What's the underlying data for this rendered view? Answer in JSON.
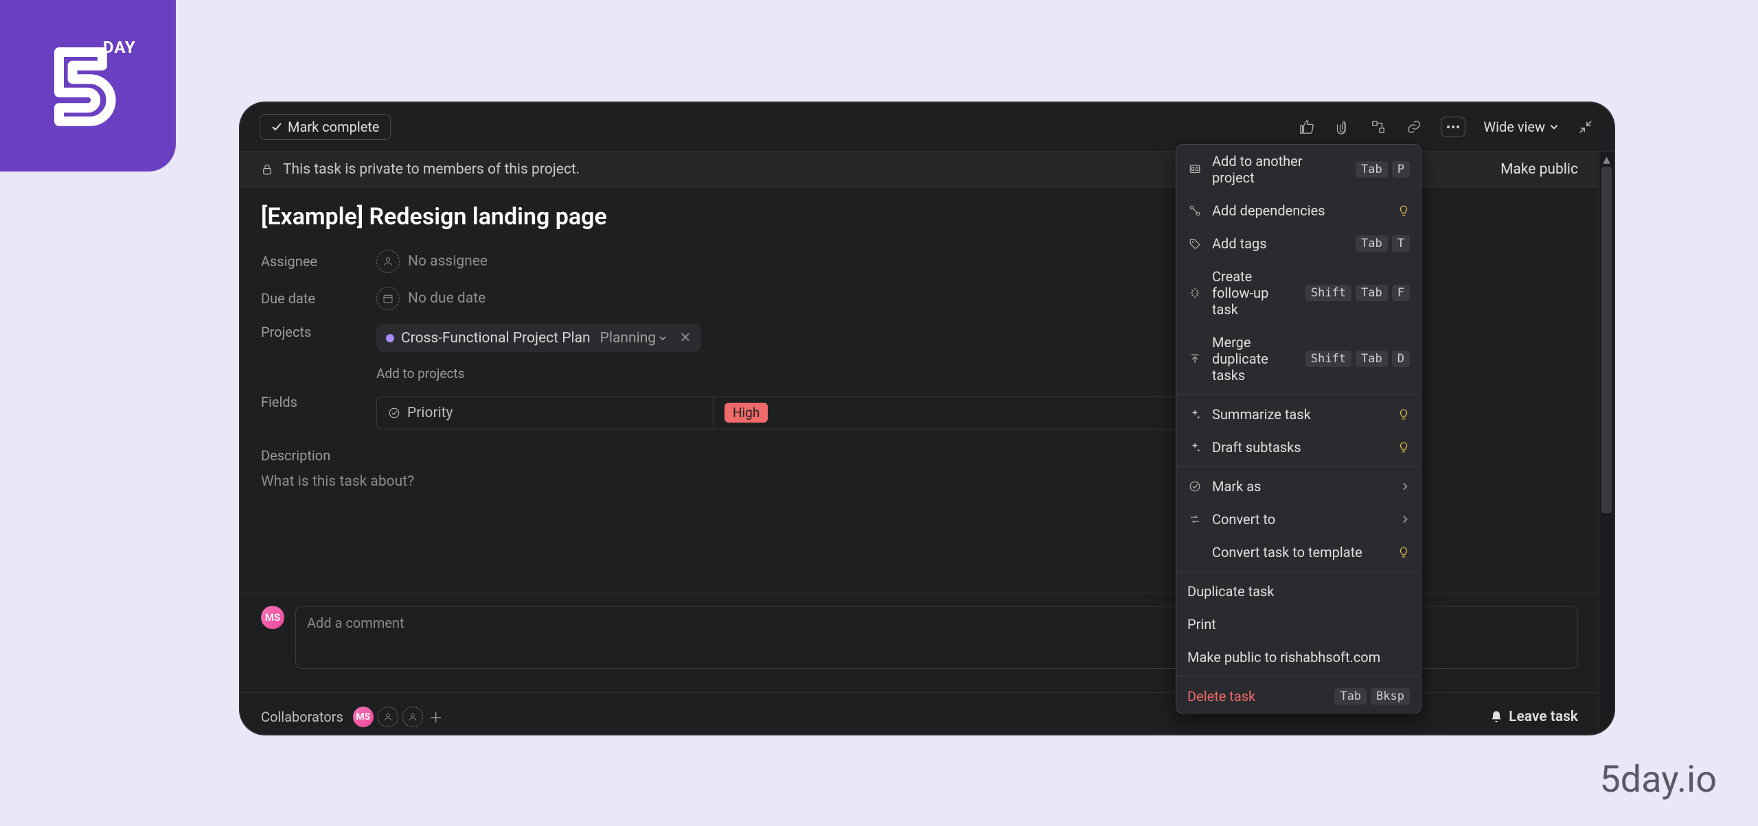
{
  "branding": {
    "logo_day": "DAY",
    "footer_url": "5day.io"
  },
  "topbar": {
    "mark_complete": "Mark complete",
    "wide_view": "Wide view"
  },
  "privacy": {
    "message": "This task is private to members of this project.",
    "make_public": "Make public"
  },
  "task": {
    "title": "[Example] Redesign landing page",
    "labels": {
      "assignee": "Assignee",
      "due_date": "Due date",
      "projects": "Projects",
      "fields": "Fields",
      "description": "Description"
    },
    "assignee_value": "No assignee",
    "due_date_value": "No due date",
    "project_name": "Cross-Functional Project Plan",
    "project_section": "Planning",
    "add_to_projects": "Add to projects",
    "custom_field_name": "Priority",
    "custom_field_value": "High",
    "description_placeholder": "What is this task about?"
  },
  "comment": {
    "placeholder": "Add a comment",
    "avatar": "MS"
  },
  "footer": {
    "collaborators_label": "Collaborators",
    "avatar": "MS",
    "leave_task": "Leave task"
  },
  "menu": {
    "items": [
      {
        "icon": "project",
        "label": "Add to another project",
        "shortcut": [
          "Tab",
          "P"
        ]
      },
      {
        "icon": "deps",
        "label": "Add dependencies",
        "badge": "bulb"
      },
      {
        "icon": "tag",
        "label": "Add tags",
        "shortcut": [
          "Tab",
          "T"
        ]
      },
      {
        "icon": "loader",
        "label": "Create follow-up task",
        "shortcut": [
          "Shift",
          "Tab",
          "F"
        ]
      },
      {
        "icon": "merge",
        "label": "Merge duplicate tasks",
        "shortcut": [
          "Shift",
          "Tab",
          "D"
        ]
      }
    ],
    "ai_items": [
      {
        "icon": "sparkle",
        "label": "Summarize task",
        "badge": "bulb"
      },
      {
        "icon": "sparkle",
        "label": "Draft subtasks",
        "badge": "bulb"
      }
    ],
    "submenu_items": [
      {
        "icon": "check",
        "label": "Mark as",
        "chevron": true
      },
      {
        "icon": "convert",
        "label": "Convert to",
        "chevron": true
      },
      {
        "icon": "",
        "label": "Convert task to template",
        "badge": "bulb"
      }
    ],
    "plain_items": [
      {
        "label": "Duplicate task"
      },
      {
        "label": "Print"
      },
      {
        "label": "Make public to rishabhsoft.com"
      }
    ],
    "delete": {
      "label": "Delete task",
      "shortcut": [
        "Tab",
        "Bksp"
      ]
    }
  }
}
